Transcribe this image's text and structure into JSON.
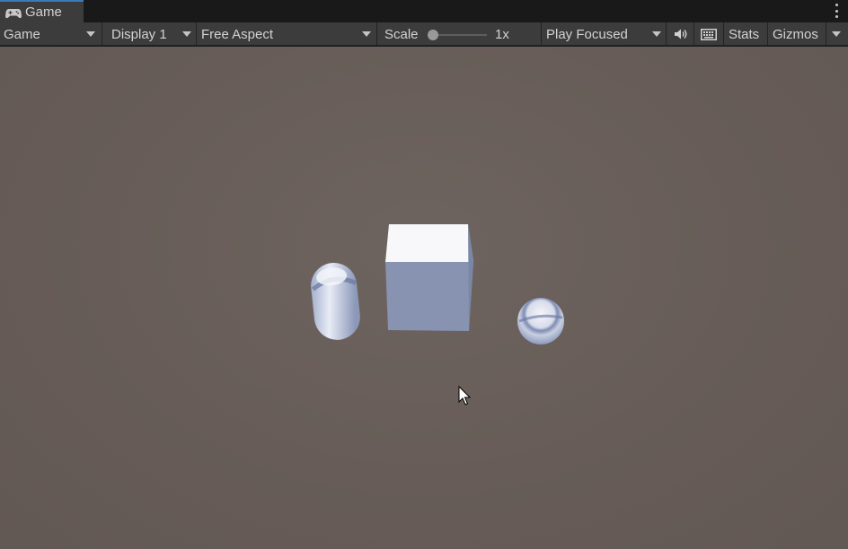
{
  "tab": {
    "label": "Game",
    "icon": "gamepad-icon"
  },
  "toolbar": {
    "view_select": "Game",
    "display_select": "Display 1",
    "aspect_select": "Free Aspect",
    "scale_label": "Scale",
    "scale_value": "1x",
    "play_mode_select": "Play Focused",
    "stats_label": "Stats",
    "gizmos_label": "Gizmos",
    "audio_icon": "speaker-icon",
    "keyboard_icon": "keyboard-icon"
  },
  "viewport": {
    "background_color": "#675c57",
    "objects": [
      "capsule",
      "cube",
      "sphere"
    ],
    "cursor": "mouse-pointer-icon"
  }
}
